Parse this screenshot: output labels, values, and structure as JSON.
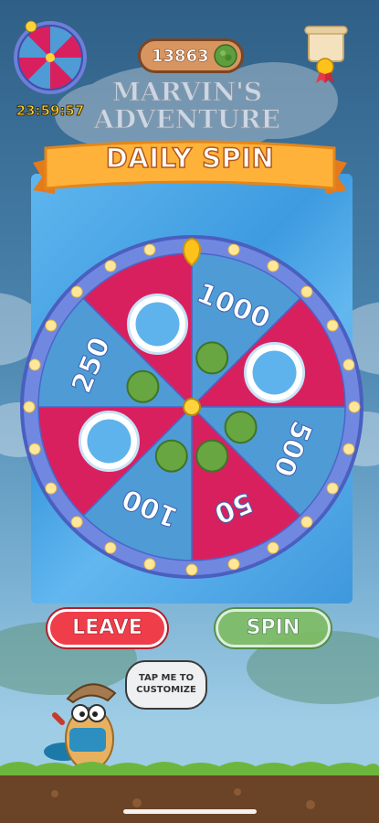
{
  "hud": {
    "timer": "23:59:57",
    "coins": "13863",
    "title_line1": "MARVIN'S",
    "title_line2": "ADVENTURE"
  },
  "banner": {
    "title": "DAILY SPIN"
  },
  "wheel": {
    "colors": {
      "pink": "#d9205f",
      "blue": "#4f9bd6",
      "rim": "#6e7fd9",
      "bulb": "#ffe79a"
    },
    "segments": [
      {
        "prize": "1000",
        "icon": "coin-icon",
        "color": "blue"
      },
      {
        "prize": "",
        "icon": "vortex-icon",
        "color": "pink"
      },
      {
        "prize": "500",
        "icon": "coin-icon",
        "color": "blue"
      },
      {
        "prize": "50",
        "icon": "coin-icon",
        "color": "pink"
      },
      {
        "prize": "100",
        "icon": "coin-icon",
        "color": "blue"
      },
      {
        "prize": "",
        "icon": "bubble-icon",
        "color": "pink"
      },
      {
        "prize": "250",
        "icon": "coin-icon",
        "color": "blue"
      },
      {
        "prize": "",
        "icon": "refresh-icon",
        "color": "pink"
      }
    ]
  },
  "buttons": {
    "leave": "LEAVE",
    "spin": "SPIN"
  },
  "speech": {
    "line1": "TAP ME TO",
    "line2": "CUSTOMIZE"
  }
}
